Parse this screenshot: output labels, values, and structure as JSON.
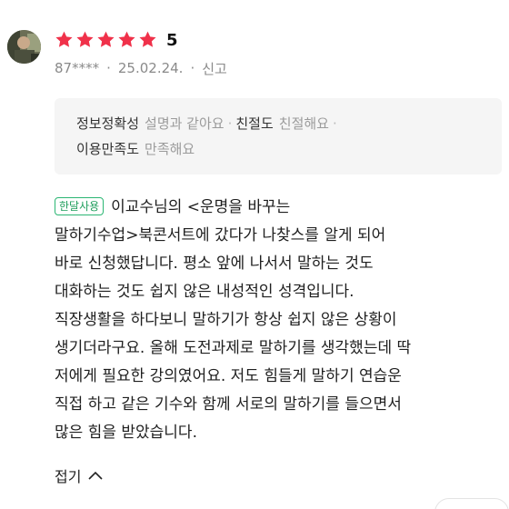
{
  "review": {
    "rating": {
      "stars_filled": 5,
      "stars_total": 5,
      "value": "5",
      "star_color": "#f0314a"
    },
    "meta": {
      "user": "87****",
      "date": "25.02.24.",
      "report": "신고"
    },
    "info": {
      "accuracy_label": "정보정확성",
      "accuracy_value": "설명과 같아요",
      "kindness_label": "친절도",
      "kindness_value": "친절해요",
      "satisfaction_label": "이용만족도",
      "satisfaction_value": "만족해요"
    },
    "badge": "한달사용",
    "badge_color": "#2bb673",
    "lines": [
      "이교수님의 <운명을 바꾸는",
      "말하기수업>북콘서트에 갔다가 나찾스를 알게 되어",
      "바로 신청했답니다. 평소 앞에 나서서 말하는 것도",
      "대화하는 것도 쉽지 않은 내성적인 성격입니다.",
      "직장생활을 하다보니 말하기가 항상 쉽지 않은 상황이",
      "생기더라구요. 올해 도전과제로 말하기를 생각했는데 딱",
      "저에게 필요한 강의였어요. 저도 힘들게 말하기 연습운",
      "직접 하고 같은 기수와 함께 서로의 말하기를 들으면서",
      "많은 힘을 받았습니다."
    ],
    "collapse_label": "접기",
    "collapse_icon": "chevron-up-icon"
  }
}
